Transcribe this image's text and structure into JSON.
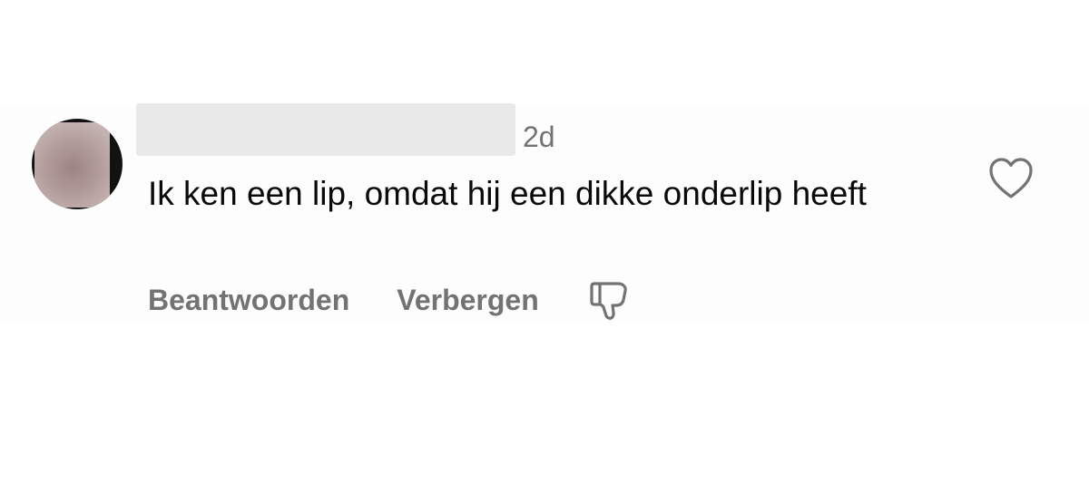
{
  "comment": {
    "time": "2d",
    "text": "Ik ken een lip, omdat hij een dikke onderlip heeft",
    "actions": {
      "reply_label": "Beantwoorden",
      "hide_label": "Verbergen"
    },
    "icons": {
      "like": "heart-outline-icon",
      "dislike": "thumbs-down-outline-icon"
    }
  },
  "colors": {
    "text_primary": "#0a0a0a",
    "text_secondary": "#737373",
    "background": "#ffffff"
  }
}
